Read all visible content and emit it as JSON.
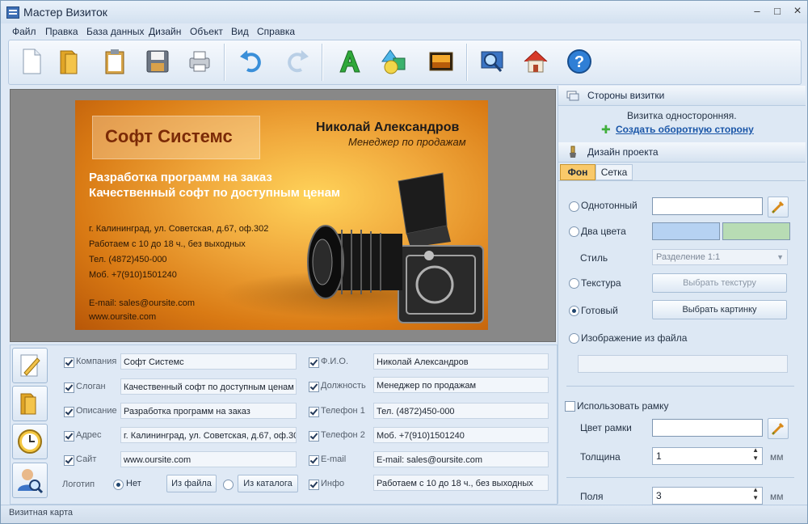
{
  "window": {
    "title": "Мастер Визиток",
    "minimize": "–",
    "maximize": "□",
    "close": "×"
  },
  "menu": [
    "Файл",
    "Правка",
    "База данных",
    "Дизайн",
    "Объект",
    "Вид",
    "Справка"
  ],
  "card": {
    "company": "Софт Системс",
    "name": "Николай Александров",
    "position": "Менеджер по продажам",
    "slogan_line1": "Разработка программ на заказ",
    "slogan_line2": "Качественный софт по доступным ценам",
    "address": "г. Калининград, ул. Советская, д.67, оф.302",
    "hours": "Работаем с 10 до 18 ч., без выходных",
    "phone": "Тел. (4872)450-000",
    "mobile": "Моб. +7(910)1501240",
    "email": "E-mail: sales@oursite.com",
    "site": "www.oursite.com"
  },
  "fields": {
    "company": {
      "label": "Компания",
      "value": "Софт Системс"
    },
    "slogan": {
      "label": "Слоган",
      "value": "Качественный софт по доступным ценам"
    },
    "description": {
      "label": "Описание",
      "value": "Разработка программ на заказ"
    },
    "address": {
      "label": "Адрес",
      "value": "г. Калининград, ул. Советская, д.67, оф.30"
    },
    "site": {
      "label": "Сайт",
      "value": "www.oursite.com"
    },
    "logo": {
      "label": "Логотип",
      "none": "Нет",
      "from_file": "Из файла",
      "from_catalog": "Из каталога"
    },
    "fio": {
      "label": "Ф.И.О.",
      "value": "Николай Александров"
    },
    "position": {
      "label": "Должность",
      "value": "Менеджер по продажам"
    },
    "phone1": {
      "label": "Телефон 1",
      "value": "Тел. (4872)450-000"
    },
    "phone2": {
      "label": "Телефон 2",
      "value": "Моб. +7(910)1501240"
    },
    "email": {
      "label": "E-mail",
      "value": "E-mail: sales@oursite.com"
    },
    "info": {
      "label": "Инфо",
      "value": "Работаем с 10 до 18 ч., без выходных"
    }
  },
  "sides": {
    "header": "Стороны визитки",
    "status": "Визитка односторонняя.",
    "create_back": "Создать оборотную сторону"
  },
  "design": {
    "header": "Дизайн проекта",
    "tab_bg": "Фон",
    "tab_grid": "Сетка",
    "solid": "Однотонный",
    "two_colors": "Два цвета",
    "style_label": "Стиль",
    "style_value": "Разделение 1:1",
    "texture": "Текстура",
    "choose_texture": "Выбрать текстуру",
    "ready": "Готовый",
    "choose_image": "Выбрать картинку",
    "image_from_file": "Изображение из файла",
    "use_frame": "Использовать рамку",
    "frame_color": "Цвет рамки",
    "thickness_label": "Толщина",
    "thickness_value": "1",
    "thickness_unit": "мм",
    "margins_label": "Поля",
    "margins_value": "3",
    "margins_unit": "мм"
  },
  "colors": {
    "color1": "#b6d2f2",
    "color2": "#b8dcb4",
    "accent": "#2a6fb8"
  },
  "status": "Визитная карта"
}
